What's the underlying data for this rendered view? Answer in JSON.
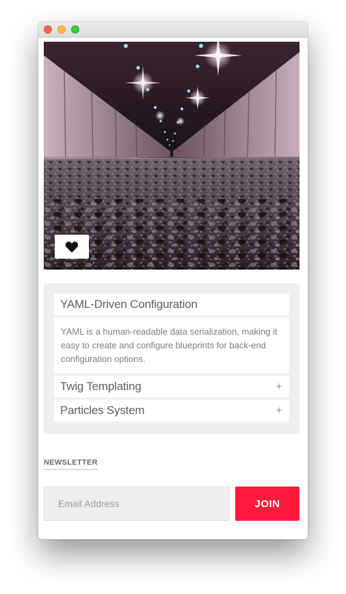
{
  "hero": {
    "image_subject": "tunnel-road-lights-photo",
    "like_icon": "heart-icon"
  },
  "accordion": {
    "items": [
      {
        "title": "YAML-Driven Configuration",
        "expanded": true,
        "body": "YAML is a human-readable data serialization, making it easy to create and configure blueprints for back-end configuration options."
      },
      {
        "title": "Twig Templating",
        "expanded": false,
        "toggle": "+"
      },
      {
        "title": "Particles System",
        "expanded": false,
        "toggle": "+"
      }
    ]
  },
  "newsletter": {
    "label": "NEWSLETTER",
    "email_placeholder": "Email Address",
    "email_value": "",
    "join_label": "JOIN"
  },
  "colors": {
    "accent": "#ff1a3c",
    "panel_bg": "#efefef",
    "text": "#5f5f5f"
  }
}
